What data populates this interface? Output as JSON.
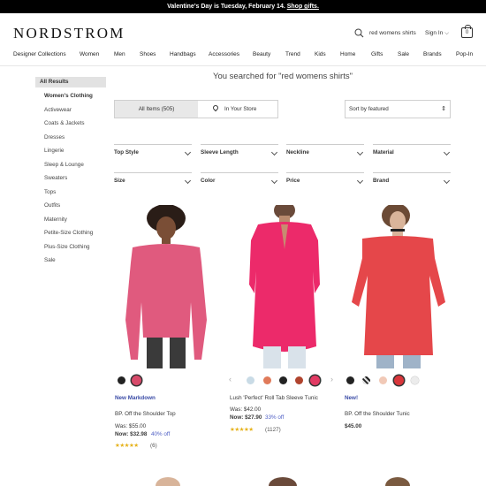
{
  "banner": {
    "text": "Valentine's Day is Tuesday, February 14.",
    "link": "Shop gifts."
  },
  "header": {
    "logo": "NORDSTROM",
    "search_value": "red womens shirts",
    "signin": "Sign In",
    "bag_count": "0"
  },
  "nav": [
    "Designer Collections",
    "Women",
    "Men",
    "Shoes",
    "Handbags",
    "Accessories",
    "Beauty",
    "Trend",
    "Kids",
    "Home",
    "Gifts",
    "Sale",
    "Brands",
    "Pop-In"
  ],
  "sidebar": {
    "all_results": "All Results",
    "items": [
      "Women's Clothing",
      "Activewear",
      "Coats & Jackets",
      "Dresses",
      "Lingerie",
      "Sleep & Lounge",
      "Sweaters",
      "Tops",
      "Outfits",
      "Maternity",
      "Petite-Size Clothing",
      "Plus-Size Clothing",
      "Sale"
    ]
  },
  "results_heading": "You searched for \"red womens shirts\"",
  "tabs": {
    "all_items": "All Items (505)",
    "in_store": "In Your Store"
  },
  "sort": {
    "label": "Sort by featured"
  },
  "filters": [
    "Top Style",
    "Sleeve Length",
    "Neckline",
    "Material",
    "Size",
    "Color",
    "Price",
    "Brand"
  ],
  "products": [
    {
      "badge": "New Markdown",
      "name": "BP. Off the Shoulder Top",
      "was": "Was: $55.00",
      "now": "Now: $32.98",
      "pct": "40% off",
      "price": "",
      "reviews": "(6)",
      "swatches": [
        "#222222",
        "#d84a6a"
      ]
    },
    {
      "badge": "",
      "name": "Lush 'Perfect' Roll Tab Sleeve Tunic",
      "was": "Was: $42.00",
      "now": "Now: $27.90",
      "pct": "33% off",
      "price": "",
      "reviews": "(1127)",
      "swatches": [
        "#c9dbe6",
        "#e07a5a",
        "#222222",
        "#b0442e",
        "#e23a63"
      ]
    },
    {
      "badge": "New!",
      "name": "BP. Off the Shoulder Tunic",
      "was": "",
      "now": "",
      "pct": "",
      "price": "$45.00",
      "reviews": "",
      "swatches": [
        "#222222",
        "#555555",
        "#f1c9b7",
        "#d9363b",
        "#ececec"
      ]
    }
  ],
  "colors": {
    "accent_blue": "#3a4ba6",
    "star": "#e6b21a"
  }
}
